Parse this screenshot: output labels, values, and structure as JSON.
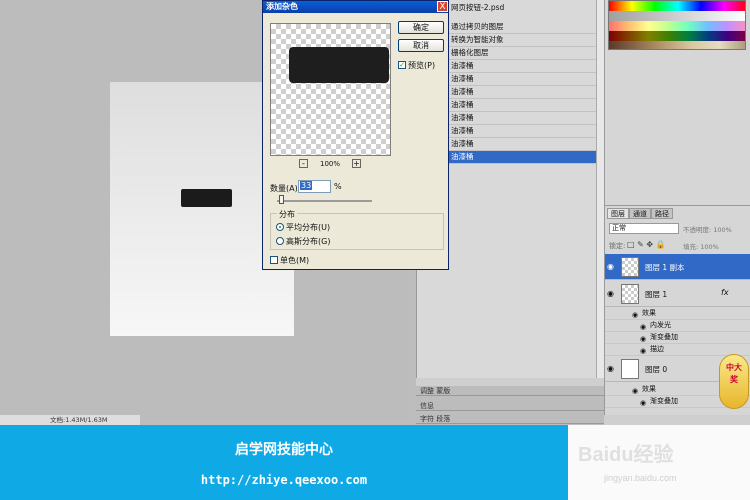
{
  "dialog": {
    "title": "添加杂色",
    "close_label": "X",
    "ok_label": "确定",
    "cancel_label": "取消",
    "preview_check_label": "预览(P)",
    "preview_zoom": "100%",
    "zoom_out_label": "-",
    "zoom_in_label": "+",
    "amount_label": "数量(A):",
    "amount_value": "33",
    "amount_unit": "%",
    "distribution_title": "分布",
    "uniform_label": "平均分布(U)",
    "gaussian_label": "高斯分布(G)",
    "monochrome_label": "单色(M)"
  },
  "history": {
    "file_label": "网页按钮-2.psd",
    "items": [
      {
        "label": "通过拷贝的图层",
        "selected": false
      },
      {
        "label": "转换为智能对象",
        "selected": false
      },
      {
        "label": "栅格化图层",
        "selected": false
      },
      {
        "label": "油漆桶",
        "selected": false
      },
      {
        "label": "油漆桶",
        "selected": false
      },
      {
        "label": "油漆桶",
        "selected": false
      },
      {
        "label": "油漆桶",
        "selected": false
      },
      {
        "label": "油漆桶",
        "selected": false
      },
      {
        "label": "油漆桶",
        "selected": false
      },
      {
        "label": "油漆桶",
        "selected": false
      },
      {
        "label": "油漆桶",
        "selected": true
      }
    ],
    "collapsed_tabs": [
      "调整   蒙版",
      "信息",
      "字符   段落"
    ]
  },
  "layers": {
    "tabs": [
      "图层",
      "通道",
      "路径"
    ],
    "blend_mode": "正常",
    "opacity_label": "不透明度: 100%",
    "lock_label": "锁定:",
    "fill_label": "填充: 100%",
    "layer_copy": "图层 1 副本",
    "layer_1": "图层 1",
    "layer_1_effects": [
      "效果",
      "内发光",
      "渐变叠加",
      "描边"
    ],
    "layer_0": "图层 0",
    "layer_0_effects": [
      "效果",
      "渐变叠加"
    ],
    "fx": "fx"
  },
  "footer": {
    "doc_info": "文档:1.43M/1.63M"
  },
  "banner": {
    "title": "启学网技能中心",
    "url": "http://zhiye.qeexoo.com"
  },
  "watermark": {
    "logo": "Baidu经验",
    "url": "jingyan.baidu.com"
  },
  "badge": {
    "text": "中大奖"
  },
  "colors": {
    "selection": "#3169c6",
    "banner": "#0fa9e6",
    "xp_title": "#0a5fd8"
  }
}
